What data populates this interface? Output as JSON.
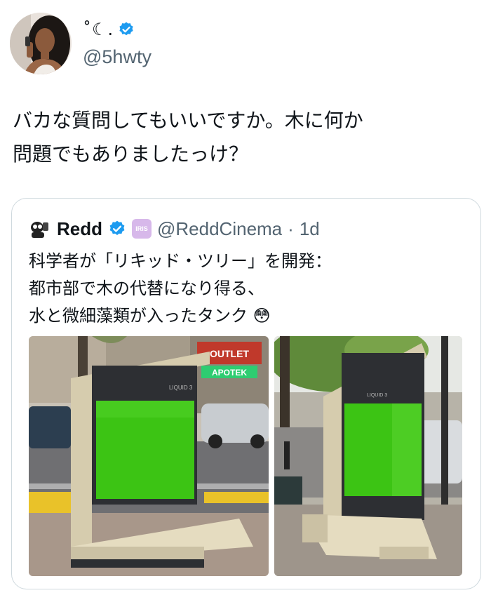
{
  "author": {
    "display_name": "˚☾.",
    "handle": "@5hwty",
    "verified": true
  },
  "tweet": {
    "text": "バカな質問してもいいですか。木に何か\n問題でもありましたっけ？"
  },
  "quote": {
    "name": "Redd",
    "badge_label": "IRIS",
    "handle": "@ReddCinema",
    "separator": "·",
    "time": "1d",
    "text": "科学者が「リキッド・ツリー」を開発：\n都市部で木の代替になり得る、\n水と微細藻類が入ったタンク 😳",
    "images": [
      {
        "name": "liquid-tree-street-photo",
        "device_label": "LIQUID 3",
        "signs": [
          "OUTLET",
          "APOTEK"
        ]
      },
      {
        "name": "liquid-tree-sidewalk-photo",
        "device_label": "LIQUID 3"
      }
    ]
  },
  "colors": {
    "verified_blue": "#1d9bf0",
    "secondary_text": "#536471",
    "border": "#cfd9de",
    "algae_green": "#3cc414"
  }
}
